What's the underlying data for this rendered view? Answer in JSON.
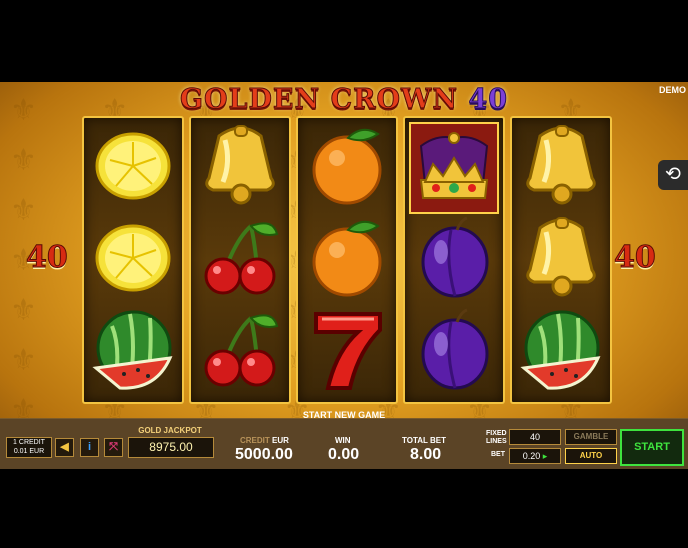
{
  "title": {
    "part1": "GOLDEN CROWN",
    "part2": "40"
  },
  "demo_label": "DEMO",
  "lines_badge": "40",
  "reels": [
    [
      "lemon",
      "lemon",
      "watermelon"
    ],
    [
      "bell",
      "cherries",
      "cherries"
    ],
    [
      "orange",
      "orange",
      "seven"
    ],
    [
      "crown",
      "plum",
      "plum"
    ],
    [
      "bell",
      "bell",
      "watermelon"
    ]
  ],
  "highlighted_symbol": "crown",
  "start_new_game": "START NEW GAME",
  "panel": {
    "credit_box": {
      "line1": "1 CREDIT",
      "line2": "0.01 EUR"
    },
    "jackpot": {
      "label": "GOLD JACKPOT",
      "value": "8975.00"
    },
    "credit": {
      "label": "CREDIT",
      "currency": "EUR",
      "value": "5000.00"
    },
    "win": {
      "label": "WIN",
      "value": "0.00"
    },
    "total_bet": {
      "label": "TOTAL BET",
      "value": "8.00"
    },
    "fixed_lines": {
      "label_1": "FIXED",
      "label_2": "LINES",
      "value": "40"
    },
    "bet": {
      "label": "BET",
      "value": "0.20"
    },
    "gamble": "GAMBLE",
    "auto": "AUTO",
    "start": "START"
  },
  "icons": [
    "sound-icon",
    "info-icon",
    "fullscreen-icon",
    "replay-icon"
  ],
  "colors": {
    "gold": "#f3c441",
    "green_button": "#3ee33e",
    "panel": "#5b4426",
    "lines_red": "#d72b12"
  }
}
